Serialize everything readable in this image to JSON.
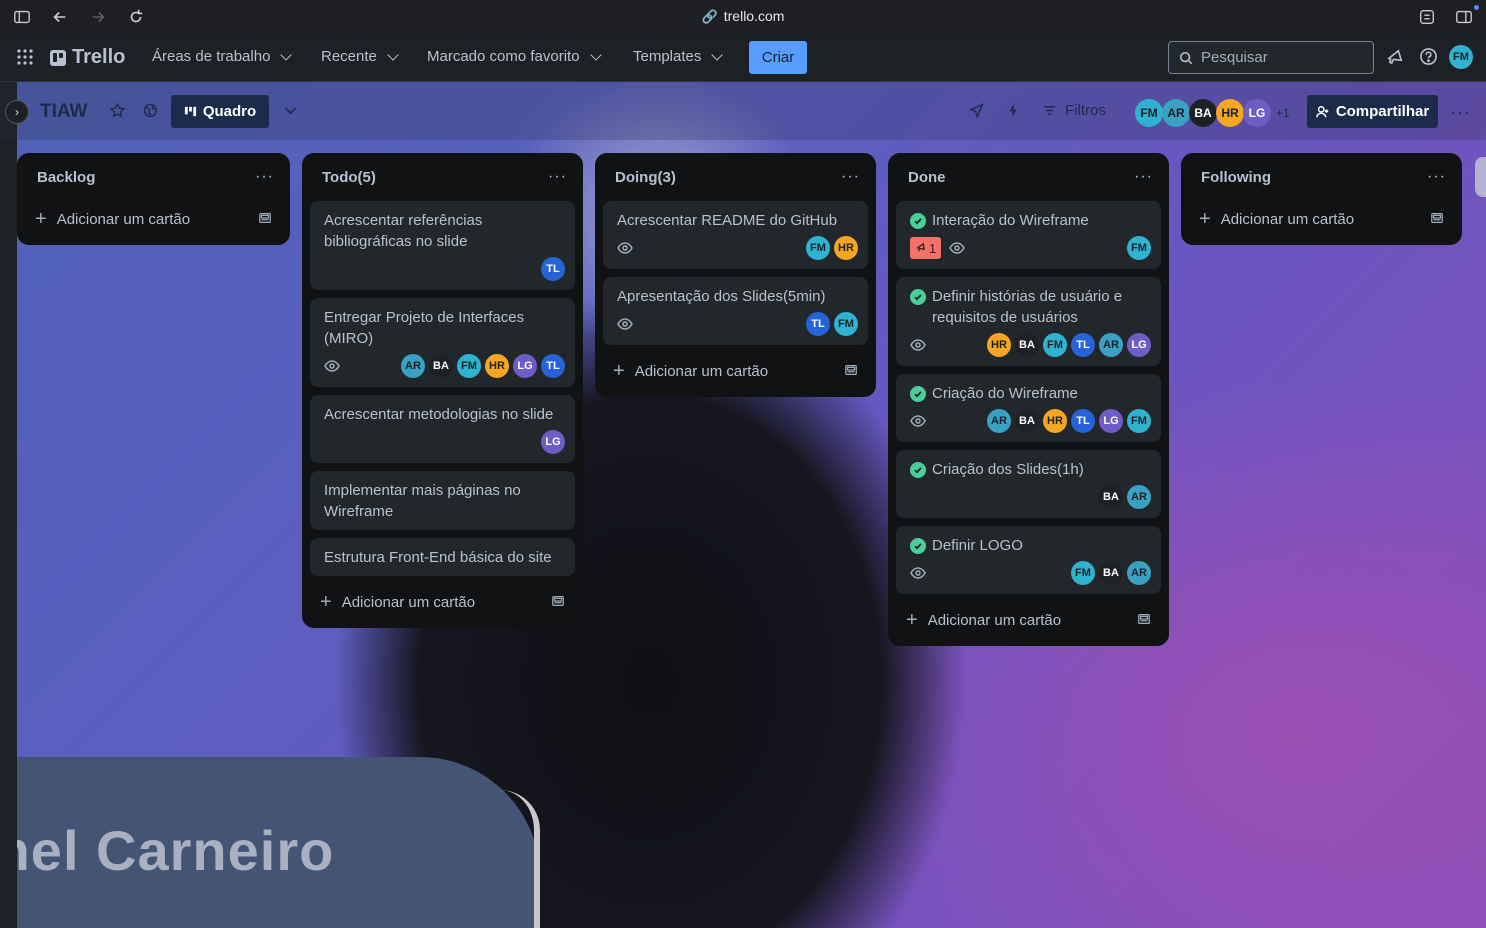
{
  "browser": {
    "url": "trello.com"
  },
  "app": {
    "logo": "Trello",
    "nav": [
      {
        "label": "Áreas de trabalho"
      },
      {
        "label": "Recente"
      },
      {
        "label": "Marcado como favorito"
      },
      {
        "label": "Templates"
      }
    ],
    "create_label": "Criar",
    "search_placeholder": "Pesquisar",
    "user_initials": "FM"
  },
  "board": {
    "title": "TIAW",
    "view_label": "Quadro",
    "filters_label": "Filtros",
    "members": [
      "FM",
      "AR",
      "BA",
      "HR",
      "LG"
    ],
    "extra_members": "+1",
    "share_label": "Compartilhar"
  },
  "lists": [
    {
      "title": "Backlog",
      "add_label": "Adicionar um cartão",
      "cards": []
    },
    {
      "title": "Todo(5)",
      "add_label": "Adicionar um cartão",
      "cards": [
        {
          "title": "Acrescentar referências bibliográficas no slide",
          "watch": false,
          "members": [
            "TL"
          ]
        },
        {
          "title": "Entregar Projeto de Interfaces (MIRO)",
          "watch": true,
          "members": [
            "AR",
            "BA",
            "FM",
            "HR",
            "LG",
            "TL"
          ]
        },
        {
          "title": "Acrescentar metodologias no slide",
          "watch": false,
          "members": [
            "LG"
          ]
        },
        {
          "title": "Implementar mais páginas no Wireframe",
          "watch": false,
          "members": []
        },
        {
          "title": "Estrutura Front-End básica do site",
          "watch": false,
          "members": []
        }
      ]
    },
    {
      "title": "Doing(3)",
      "add_label": "Adicionar um cartão",
      "cards": [
        {
          "title": "Acrescentar README do GitHub",
          "watch": true,
          "members": [
            "FM",
            "HR"
          ]
        },
        {
          "title": "Apresentação dos Slides(5min)",
          "watch": true,
          "members": [
            "TL",
            "FM"
          ]
        }
      ]
    },
    {
      "title": "Done",
      "add_label": "Adicionar um cartão",
      "cards": [
        {
          "title": "Interação do Wireframe",
          "done": true,
          "badge": "1",
          "watch": true,
          "members": [
            "FM"
          ]
        },
        {
          "title": "Definir histórias de usuário e requisitos de usuários",
          "done": true,
          "watch": true,
          "members": [
            "HR",
            "BA",
            "FM",
            "TL",
            "AR",
            "LG"
          ]
        },
        {
          "title": "Criação do Wireframe",
          "done": true,
          "watch": true,
          "members": [
            "AR",
            "BA",
            "HR",
            "TL",
            "LG",
            "FM"
          ]
        },
        {
          "title": "Criação dos Slides(1h)",
          "done": true,
          "watch": false,
          "members": [
            "BA",
            "AR"
          ]
        },
        {
          "title": "Definir LOGO",
          "done": true,
          "watch": true,
          "members": [
            "FM",
            "BA",
            "AR"
          ]
        }
      ]
    },
    {
      "title": "Following",
      "add_label": "Adicionar um cartão",
      "cards": []
    }
  ],
  "overlay": {
    "name_text": "mel Carneiro"
  }
}
